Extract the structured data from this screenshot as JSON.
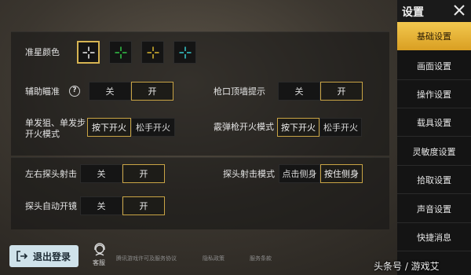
{
  "sidebar": {
    "title": "设置",
    "items": [
      {
        "label": "基础设置",
        "active": true
      },
      {
        "label": "画面设置",
        "active": false
      },
      {
        "label": "操作设置",
        "active": false
      },
      {
        "label": "载具设置",
        "active": false
      },
      {
        "label": "灵敏度设置",
        "active": false
      },
      {
        "label": "拾取设置",
        "active": false
      },
      {
        "label": "声音设置",
        "active": false
      },
      {
        "label": "快捷消息",
        "active": false
      }
    ]
  },
  "crosshair": {
    "label": "准星颜色",
    "options": [
      {
        "color": "#ffffff",
        "selected": true
      },
      {
        "color": "#34d24a",
        "selected": false
      },
      {
        "color": "#e8c230",
        "selected": false
      },
      {
        "color": "#39d8dc",
        "selected": false
      }
    ]
  },
  "aim_assist": {
    "label": "辅助瞄准",
    "help": "?",
    "off": "关",
    "on": "开",
    "value": "开"
  },
  "muzzle_hint": {
    "label": "枪口顶墙提示",
    "off": "关",
    "on": "开",
    "value": "开"
  },
  "single_fire": {
    "label_line1": "单发狙、单发步",
    "label_line2": "开火模式",
    "press": "按下开火",
    "release": "松手开火",
    "value": "按下开火"
  },
  "shotgun_fire": {
    "label": "霰弹枪开火模式",
    "press": "按下开火",
    "release": "松手开火",
    "value": "按下开火"
  },
  "peek_fire": {
    "label": "左右探头射击",
    "off": "关",
    "on": "开",
    "value": "开"
  },
  "peek_mode": {
    "label": "探头射击模式",
    "tap": "点击侧身",
    "hold": "按住侧身",
    "value": "按住侧身"
  },
  "peek_scope": {
    "label": "探头自动开镜",
    "off": "关",
    "on": "开",
    "value": "开"
  },
  "footer": {
    "logout": "退出登录",
    "customer_service": "客服",
    "links": [
      "腾讯游戏许可及服务协议",
      "隐私政策",
      "服务条款"
    ]
  },
  "watermark": "头条号 / 游戏艾"
}
